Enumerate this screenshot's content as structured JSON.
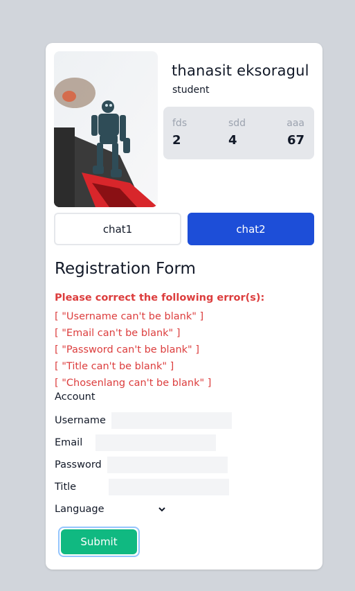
{
  "profile": {
    "name": "thanasit eksoragul",
    "role": "student",
    "photo_icon": "robot-figure-photo"
  },
  "stats": [
    {
      "label": "fds",
      "value": "2"
    },
    {
      "label": "sdd",
      "value": "4"
    },
    {
      "label": "aaa",
      "value": "67"
    }
  ],
  "tabs": {
    "chat1": "chat1",
    "chat2": "chat2"
  },
  "form": {
    "title": "Registration Form",
    "error_heading": "Please correct the following error(s):",
    "errors": [
      "[ \"Username can't be blank\" ]",
      "[ \"Email can't be blank\" ]",
      "[ \"Password can't be blank\" ]",
      "[ \"Title can't be blank\" ]",
      "[ \"Chosenlang can't be blank\" ]"
    ],
    "section_label": "Account",
    "fields": {
      "username": {
        "label": "Username",
        "value": ""
      },
      "email": {
        "label": "Email",
        "value": ""
      },
      "password": {
        "label": "Password",
        "value": ""
      },
      "title": {
        "label": "Title",
        "value": ""
      },
      "language": {
        "label": "Language",
        "selected": ""
      }
    },
    "submit_label": "Submit"
  },
  "colors": {
    "page_bg": "#d1d5db",
    "primary": "#1d4ed8",
    "error": "#dc3d3d",
    "submit": "#10b981"
  }
}
